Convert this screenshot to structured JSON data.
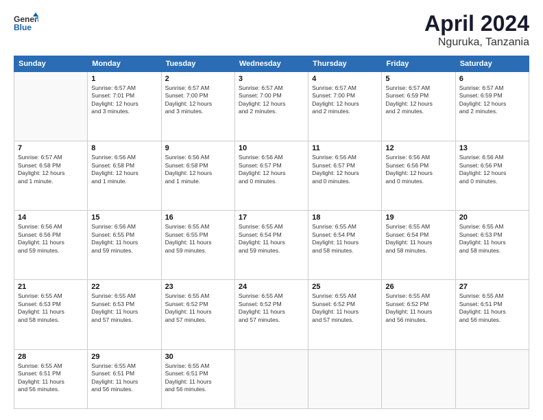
{
  "logo": {
    "general": "General",
    "blue": "Blue"
  },
  "header": {
    "month": "April 2024",
    "location": "Nguruka, Tanzania"
  },
  "weekdays": [
    "Sunday",
    "Monday",
    "Tuesday",
    "Wednesday",
    "Thursday",
    "Friday",
    "Saturday"
  ],
  "weeks": [
    [
      {
        "day": "",
        "info": ""
      },
      {
        "day": "1",
        "info": "Sunrise: 6:57 AM\nSunset: 7:01 PM\nDaylight: 12 hours\nand 3 minutes."
      },
      {
        "day": "2",
        "info": "Sunrise: 6:57 AM\nSunset: 7:00 PM\nDaylight: 12 hours\nand 3 minutes."
      },
      {
        "day": "3",
        "info": "Sunrise: 6:57 AM\nSunset: 7:00 PM\nDaylight: 12 hours\nand 2 minutes."
      },
      {
        "day": "4",
        "info": "Sunrise: 6:57 AM\nSunset: 7:00 PM\nDaylight: 12 hours\nand 2 minutes."
      },
      {
        "day": "5",
        "info": "Sunrise: 6:57 AM\nSunset: 6:59 PM\nDaylight: 12 hours\nand 2 minutes."
      },
      {
        "day": "6",
        "info": "Sunrise: 6:57 AM\nSunset: 6:59 PM\nDaylight: 12 hours\nand 2 minutes."
      }
    ],
    [
      {
        "day": "7",
        "info": "Sunrise: 6:57 AM\nSunset: 6:58 PM\nDaylight: 12 hours\nand 1 minute."
      },
      {
        "day": "8",
        "info": "Sunrise: 6:56 AM\nSunset: 6:58 PM\nDaylight: 12 hours\nand 1 minute."
      },
      {
        "day": "9",
        "info": "Sunrise: 6:56 AM\nSunset: 6:58 PM\nDaylight: 12 hours\nand 1 minute."
      },
      {
        "day": "10",
        "info": "Sunrise: 6:56 AM\nSunset: 6:57 PM\nDaylight: 12 hours\nand 0 minutes."
      },
      {
        "day": "11",
        "info": "Sunrise: 6:56 AM\nSunset: 6:57 PM\nDaylight: 12 hours\nand 0 minutes."
      },
      {
        "day": "12",
        "info": "Sunrise: 6:56 AM\nSunset: 6:56 PM\nDaylight: 12 hours\nand 0 minutes."
      },
      {
        "day": "13",
        "info": "Sunrise: 6:56 AM\nSunset: 6:56 PM\nDaylight: 12 hours\nand 0 minutes."
      }
    ],
    [
      {
        "day": "14",
        "info": "Sunrise: 6:56 AM\nSunset: 6:56 PM\nDaylight: 11 hours\nand 59 minutes."
      },
      {
        "day": "15",
        "info": "Sunrise: 6:56 AM\nSunset: 6:55 PM\nDaylight: 11 hours\nand 59 minutes."
      },
      {
        "day": "16",
        "info": "Sunrise: 6:55 AM\nSunset: 6:55 PM\nDaylight: 11 hours\nand 59 minutes."
      },
      {
        "day": "17",
        "info": "Sunrise: 6:55 AM\nSunset: 6:54 PM\nDaylight: 11 hours\nand 59 minutes."
      },
      {
        "day": "18",
        "info": "Sunrise: 6:55 AM\nSunset: 6:54 PM\nDaylight: 11 hours\nand 58 minutes."
      },
      {
        "day": "19",
        "info": "Sunrise: 6:55 AM\nSunset: 6:54 PM\nDaylight: 11 hours\nand 58 minutes."
      },
      {
        "day": "20",
        "info": "Sunrise: 6:55 AM\nSunset: 6:53 PM\nDaylight: 11 hours\nand 58 minutes."
      }
    ],
    [
      {
        "day": "21",
        "info": "Sunrise: 6:55 AM\nSunset: 6:53 PM\nDaylight: 11 hours\nand 58 minutes."
      },
      {
        "day": "22",
        "info": "Sunrise: 6:55 AM\nSunset: 6:53 PM\nDaylight: 11 hours\nand 57 minutes."
      },
      {
        "day": "23",
        "info": "Sunrise: 6:55 AM\nSunset: 6:52 PM\nDaylight: 11 hours\nand 57 minutes."
      },
      {
        "day": "24",
        "info": "Sunrise: 6:55 AM\nSunset: 6:52 PM\nDaylight: 11 hours\nand 57 minutes."
      },
      {
        "day": "25",
        "info": "Sunrise: 6:55 AM\nSunset: 6:52 PM\nDaylight: 11 hours\nand 57 minutes."
      },
      {
        "day": "26",
        "info": "Sunrise: 6:55 AM\nSunset: 6:52 PM\nDaylight: 11 hours\nand 56 minutes."
      },
      {
        "day": "27",
        "info": "Sunrise: 6:55 AM\nSunset: 6:51 PM\nDaylight: 11 hours\nand 56 minutes."
      }
    ],
    [
      {
        "day": "28",
        "info": "Sunrise: 6:55 AM\nSunset: 6:51 PM\nDaylight: 11 hours\nand 56 minutes."
      },
      {
        "day": "29",
        "info": "Sunrise: 6:55 AM\nSunset: 6:51 PM\nDaylight: 11 hours\nand 56 minutes."
      },
      {
        "day": "30",
        "info": "Sunrise: 6:55 AM\nSunset: 6:51 PM\nDaylight: 11 hours\nand 56 minutes."
      },
      {
        "day": "",
        "info": ""
      },
      {
        "day": "",
        "info": ""
      },
      {
        "day": "",
        "info": ""
      },
      {
        "day": "",
        "info": ""
      }
    ]
  ]
}
